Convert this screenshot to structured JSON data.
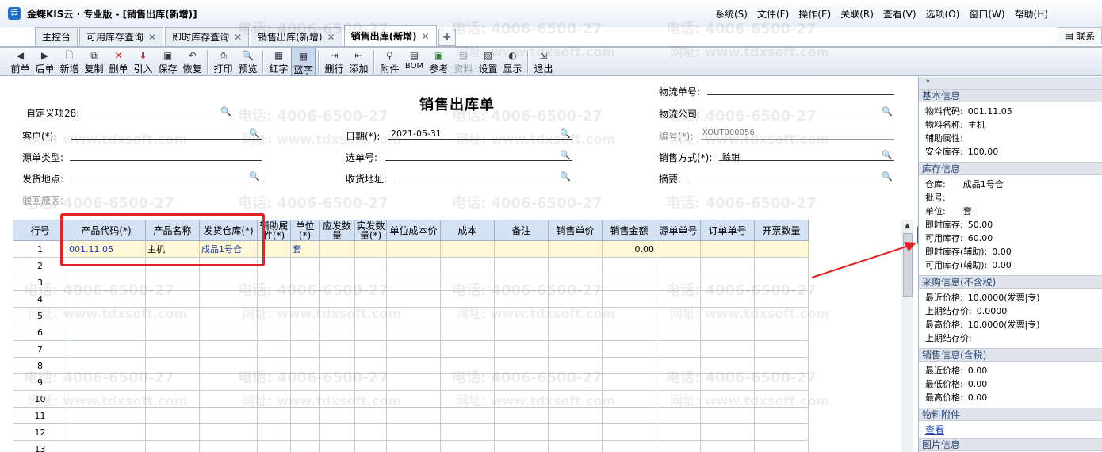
{
  "app": {
    "title": "金蝶KIS云 · 专业版 - [销售出库(新增)]",
    "icon": "kingdee-logo-icon",
    "menu": [
      "系统(S)",
      "文件(F)",
      "操作(E)",
      "关联(R)",
      "查看(V)",
      "选项(O)",
      "窗口(W)",
      "帮助(H)"
    ]
  },
  "tabs": [
    {
      "label": "主控台",
      "closable": false
    },
    {
      "label": "可用库存查询",
      "closable": true
    },
    {
      "label": "即时库存查询",
      "closable": true
    },
    {
      "label": "销售出库(新增)",
      "closable": true
    },
    {
      "label": "销售出库(新增)",
      "closable": true,
      "active": true
    }
  ],
  "contact_button": "联系",
  "toolbar": [
    {
      "label": "前单",
      "icon": "arrow-left-icon"
    },
    {
      "label": "后单",
      "icon": "arrow-right-icon"
    },
    {
      "label": "新增",
      "icon": "new-doc-icon"
    },
    {
      "label": "复制",
      "icon": "copy-icon"
    },
    {
      "label": "删单",
      "icon": "delete-icon"
    },
    {
      "label": "引入",
      "icon": "import-icon"
    },
    {
      "label": "保存",
      "icon": "save-icon"
    },
    {
      "label": "恢复",
      "icon": "restore-icon"
    },
    {
      "label": "打印",
      "icon": "print-icon"
    },
    {
      "label": "预览",
      "icon": "preview-icon"
    },
    {
      "label": "红字",
      "icon": "red-entry-icon"
    },
    {
      "label": "蓝字",
      "icon": "blue-entry-icon"
    },
    {
      "label": "删行",
      "icon": "delete-row-icon"
    },
    {
      "label": "添加",
      "icon": "add-row-icon"
    },
    {
      "label": "附件",
      "icon": "attachment-icon"
    },
    {
      "label": "BOM",
      "icon": "bom-icon"
    },
    {
      "label": "参考",
      "icon": "reference-icon"
    },
    {
      "label": "资料",
      "icon": "data-icon"
    },
    {
      "label": "设置",
      "icon": "settings-icon"
    },
    {
      "label": "显示",
      "icon": "display-icon"
    },
    {
      "label": "退出",
      "icon": "exit-icon"
    }
  ],
  "form": {
    "title": "销售出库单",
    "custom28_label": "自定义项28:",
    "customer_label": "客户(*):",
    "source_type_label": "源单类型:",
    "ship_place_label": "发货地点:",
    "reject_reason_label": "驳回原因:",
    "date_label": "日期(*):",
    "date_value": "2021-05-31",
    "select_no_label": "选单号:",
    "recv_addr_label": "收货地址:",
    "logistics_no_label": "物流单号:",
    "logistics_co_label": "物流公司:",
    "number_label": "编号(*):",
    "number_value": "XOUT000056",
    "sale_method_label": "销售方式(*):",
    "sale_method_value": "赊销",
    "summary_label": "摘要:"
  },
  "grid": {
    "headers": [
      "行号",
      "产品代码(*)",
      "产品名称",
      "发货仓库(*)",
      "辅助属性(*)",
      "单位(*)",
      "应发数量",
      "实发数量(*)",
      "单位成本价",
      "成本",
      "备注",
      "销售单价",
      "销售金额",
      "源单单号",
      "订单单号",
      "开票数量"
    ],
    "rows": [
      [
        "1",
        "001.11.05",
        "主机",
        "成品1号仓",
        "",
        "套",
        "",
        "",
        "",
        "",
        "",
        "",
        "0.00",
        "",
        "",
        ""
      ],
      [
        "2"
      ],
      [
        "3"
      ],
      [
        "4"
      ],
      [
        "5"
      ],
      [
        "6"
      ],
      [
        "7"
      ],
      [
        "8"
      ],
      [
        "9"
      ],
      [
        "10"
      ],
      [
        "11"
      ],
      [
        "12"
      ],
      [
        "13"
      ]
    ]
  },
  "side": {
    "basic": {
      "title": "基本信息",
      "items": [
        {
          "k": "物料代码:",
          "v": "001.11.05"
        },
        {
          "k": "物料名称:",
          "v": "主机"
        },
        {
          "k": "辅助属性:",
          "v": ""
        },
        {
          "k": "安全库存:",
          "v": "100.00"
        }
      ]
    },
    "stock": {
      "title": "库存信息",
      "items": [
        {
          "k": "仓库:",
          "v": "成品1号仓"
        },
        {
          "k": "批号:",
          "v": ""
        },
        {
          "k": "单位:",
          "v": "套"
        },
        {
          "k": "即时库存:",
          "v": "50.00"
        },
        {
          "k": "可用库存:",
          "v": "60.00"
        },
        {
          "k": "即时库存(辅助):",
          "v": "0.00"
        },
        {
          "k": "可用库存(辅助):",
          "v": "0.00"
        }
      ]
    },
    "purchase": {
      "title": "采购信息(不含税)",
      "items": [
        {
          "k": "最近价格:",
          "v": "10.0000(发票|专)"
        },
        {
          "k": "上期结存价:",
          "v": "0.0000"
        },
        {
          "k": "最高价格:",
          "v": "10.0000(发票|专)"
        },
        {
          "k": "上期结存价:",
          "v": ""
        }
      ]
    },
    "sales": {
      "title": "销售信息(含税)",
      "items": [
        {
          "k": "最近价格:",
          "v": "0.00"
        },
        {
          "k": "最低价格:",
          "v": "0.00"
        },
        {
          "k": "最高价格:",
          "v": "0.00"
        }
      ]
    },
    "attach": {
      "title": "物料附件",
      "link": "查看"
    },
    "picture": {
      "title": "图片信息"
    }
  },
  "watermark": {
    "phone": "电话: 4006-6500-27",
    "site": "网址: www.tdxsoft.com"
  },
  "colors": {
    "highlight": "#e52222",
    "header_bg": "#d5e2f3",
    "row_active": "#fff7d6"
  }
}
